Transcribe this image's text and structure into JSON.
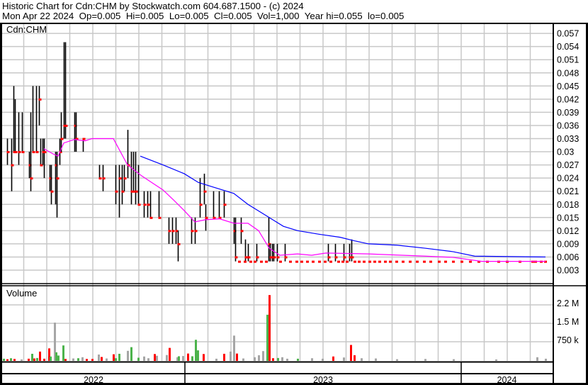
{
  "header": {
    "title": "Historic Chart for Cdn:CHM by Stockwatch.com 604.687.1500 - (c) 2024",
    "summary": "Mon Apr 22 2024  Op=0.005  Hi=0.005  Lo=0.005  Cl=0.005  Vol=1,000  Year hi=0.055  lo=0.005"
  },
  "colors": {
    "bar": "#000000",
    "close_dot": "#ff0000",
    "ma_short": "#ff00ff",
    "ma_long": "#0000ff",
    "vol_up": "#4cb34c",
    "vol_down": "#ff0000",
    "vol_flat": "#a6a6a6",
    "grid": "#c8c8c8"
  },
  "chart_data": [
    {
      "type": "line",
      "title": "Cdn:CHM",
      "xlabel": "",
      "ylabel": "",
      "xlim": [
        0,
        777
      ],
      "ylim": [
        0.0015,
        0.0585
      ],
      "grid": true,
      "yticks": [
        "0.057",
        "0.054",
        "0.051",
        "0.048",
        "0.045",
        "0.042",
        "0.039",
        "0.036",
        "0.033",
        "0.03",
        "0.027",
        "0.024",
        "0.021",
        "0.018",
        "0.015",
        "0.012",
        "0.009",
        "0.006",
        "0.003"
      ],
      "ytick_values": [
        0.057,
        0.054,
        0.051,
        0.048,
        0.045,
        0.042,
        0.039,
        0.036,
        0.033,
        0.03,
        0.027,
        0.024,
        0.021,
        0.018,
        0.015,
        0.012,
        0.009,
        0.006,
        0.003
      ],
      "bars_hlc": [
        [
          7,
          0.033,
          0.027,
          0.03
        ],
        [
          13,
          0.033,
          0.021,
          0.027
        ],
        [
          16,
          0.045,
          0.03,
          0.03
        ],
        [
          18,
          0.042,
          0.03,
          0.03
        ],
        [
          23,
          0.039,
          0.027,
          0.03
        ],
        [
          28,
          0.039,
          0.03,
          0.03
        ],
        [
          38,
          0.03,
          0.024,
          0.027
        ],
        [
          40,
          0.039,
          0.021,
          0.024
        ],
        [
          43,
          0.045,
          0.03,
          0.03
        ],
        [
          48,
          0.045,
          0.03,
          0.03
        ],
        [
          52,
          0.045,
          0.036,
          0.042
        ],
        [
          54,
          0.033,
          0.027,
          0.027
        ],
        [
          57,
          0.033,
          0.027,
          0.03
        ],
        [
          59,
          0.033,
          0.024,
          0.03
        ],
        [
          67,
          0.027,
          0.021,
          0.024
        ],
        [
          69,
          0.027,
          0.018,
          0.021
        ],
        [
          75,
          0.03,
          0.018,
          0.027
        ],
        [
          77,
          0.03,
          0.015,
          0.024
        ],
        [
          81,
          0.033,
          0.027,
          0.03
        ],
        [
          83,
          0.039,
          0.03,
          0.033
        ],
        [
          87,
          0.055,
          0.033,
          0.036
        ],
        [
          89,
          0.055,
          0.033,
          0.036
        ],
        [
          102,
          0.039,
          0.03,
          0.036
        ],
        [
          104,
          0.039,
          0.03,
          0.033
        ],
        [
          114,
          0.033,
          0.03,
          0.033
        ],
        [
          137,
          0.027,
          0.024,
          0.024
        ],
        [
          142,
          0.027,
          0.021,
          0.024
        ],
        [
          160,
          0.027,
          0.018,
          0.021
        ],
        [
          165,
          0.027,
          0.015,
          0.024
        ],
        [
          169,
          0.027,
          0.018,
          0.021
        ],
        [
          172,
          0.027,
          0.021,
          0.024
        ],
        [
          177,
          0.035,
          0.024,
          0.027
        ],
        [
          182,
          0.03,
          0.018,
          0.021
        ],
        [
          185,
          0.03,
          0.021,
          0.021
        ],
        [
          188,
          0.03,
          0.018,
          0.021
        ],
        [
          192,
          0.027,
          0.018,
          0.018
        ],
        [
          200,
          0.021,
          0.015,
          0.018
        ],
        [
          205,
          0.021,
          0.015,
          0.018
        ],
        [
          209,
          0.021,
          0.015,
          0.015
        ],
        [
          221,
          0.021,
          0.015,
          0.015
        ],
        [
          235,
          0.015,
          0.009,
          0.012
        ],
        [
          240,
          0.015,
          0.009,
          0.012
        ],
        [
          245,
          0.015,
          0.009,
          0.012
        ],
        [
          248,
          0.012,
          0.005,
          0.009
        ],
        [
          267,
          0.015,
          0.009,
          0.012
        ],
        [
          272,
          0.015,
          0.009,
          0.012
        ],
        [
          279,
          0.024,
          0.015,
          0.018
        ],
        [
          285,
          0.025,
          0.018,
          0.021
        ],
        [
          287,
          0.018,
          0.012,
          0.015
        ],
        [
          298,
          0.021,
          0.015,
          0.015
        ],
        [
          306,
          0.021,
          0.015,
          0.015
        ],
        [
          313,
          0.021,
          0.015,
          0.018
        ],
        [
          327,
          0.015,
          0.009,
          0.012
        ],
        [
          329,
          0.015,
          0.005,
          0.006
        ],
        [
          337,
          0.015,
          0.009,
          0.012
        ],
        [
          343,
          0.01,
          0.005,
          0.006
        ],
        [
          347,
          0.009,
          0.005,
          0.006
        ],
        [
          359,
          0.009,
          0.005,
          0.006
        ],
        [
          376,
          0.015,
          0.005,
          0.009
        ],
        [
          378,
          0.009,
          0.005,
          0.006
        ],
        [
          381,
          0.009,
          0.005,
          0.006
        ],
        [
          383,
          0.009,
          0.005,
          0.006
        ],
        [
          388,
          0.009,
          0.005,
          0.006
        ],
        [
          399,
          0.009,
          0.005,
          0.006
        ],
        [
          460,
          0.009,
          0.005,
          0.006
        ],
        [
          470,
          0.009,
          0.005,
          0.006
        ],
        [
          482,
          0.009,
          0.005,
          0.006
        ],
        [
          490,
          0.009,
          0.005,
          0.006
        ],
        [
          493,
          0.01,
          0.005,
          0.006
        ]
      ],
      "flat_trades_0_005": [
        334,
        342,
        350,
        356,
        365,
        372,
        392,
        406,
        415,
        422,
        430,
        438,
        447,
        455,
        463,
        474,
        480,
        486,
        497,
        503,
        510,
        518,
        525,
        532,
        540,
        547,
        556,
        565,
        575,
        585,
        595,
        604,
        616,
        625,
        636,
        648,
        660,
        672,
        684,
        700,
        712,
        730,
        748,
        752,
        760,
        766
      ],
      "series": [
        {
          "name": "short moving average",
          "color": "#ff00ff",
          "points": [
            [
              59,
              0.0307
            ],
            [
              72,
              0.0295
            ],
            [
              79,
              0.029
            ],
            [
              87,
              0.032
            ],
            [
              102,
              0.0328
            ],
            [
              117,
              0.0325
            ],
            [
              127,
              0.033
            ],
            [
              157,
              0.033
            ],
            [
              167,
              0.03
            ],
            [
              177,
              0.027
            ],
            [
              197,
              0.0245
            ],
            [
              227,
              0.0213
            ],
            [
              242,
              0.019
            ],
            [
              257,
              0.0166
            ],
            [
              272,
              0.014
            ],
            [
              287,
              0.0145
            ],
            [
              307,
              0.0147
            ],
            [
              327,
              0.0137
            ],
            [
              347,
              0.0137
            ],
            [
              362,
              0.012
            ],
            [
              377,
              0.008
            ],
            [
              392,
              0.0064
            ],
            [
              417,
              0.0067
            ],
            [
              437,
              0.0064
            ],
            [
              457,
              0.0069
            ],
            [
              517,
              0.0067
            ],
            [
              597,
              0.0062
            ],
            [
              637,
              0.0059
            ],
            [
              677,
              0.005
            ],
            [
              767,
              0.005
            ]
          ]
        },
        {
          "name": "long moving average",
          "color": "#0000ff",
          "points": [
            [
              195,
              0.029
            ],
            [
              227,
              0.027
            ],
            [
              257,
              0.025
            ],
            [
              277,
              0.023
            ],
            [
              297,
              0.022
            ],
            [
              327,
              0.0205
            ],
            [
              347,
              0.018
            ],
            [
              377,
              0.015
            ],
            [
              397,
              0.013
            ],
            [
              417,
              0.012
            ],
            [
              447,
              0.0112
            ],
            [
              477,
              0.0105
            ],
            [
              497,
              0.0097
            ],
            [
              517,
              0.009
            ],
            [
              557,
              0.0087
            ],
            [
              597,
              0.008
            ],
            [
              637,
              0.0072
            ],
            [
              667,
              0.0062
            ],
            [
              767,
              0.006
            ]
          ]
        }
      ]
    },
    {
      "type": "bar",
      "title": "Volume",
      "ylim": [
        0,
        3000000
      ],
      "yticks": [
        "2.2 M",
        "1.5 M",
        "750 k"
      ],
      "ytick_values": [
        2250000,
        1500000,
        750000
      ],
      "bars": [
        [
          2,
          60000,
          "up"
        ],
        [
          7,
          40000,
          "down"
        ],
        [
          12,
          80000,
          "up"
        ],
        [
          17,
          50000,
          "down"
        ],
        [
          27,
          30000,
          "flat"
        ],
        [
          37,
          60000,
          "down"
        ],
        [
          42,
          260000,
          "up"
        ],
        [
          45,
          70000,
          "down"
        ],
        [
          49,
          90000,
          "up"
        ],
        [
          53,
          350000,
          "down"
        ],
        [
          59,
          60000,
          "down"
        ],
        [
          66,
          480000,
          "down"
        ],
        [
          68,
          150000,
          "up"
        ],
        [
          74,
          1530000,
          "flat"
        ],
        [
          76,
          320000,
          "up"
        ],
        [
          79,
          190000,
          "up"
        ],
        [
          86,
          600000,
          "up"
        ],
        [
          89,
          50000,
          "down"
        ],
        [
          100,
          70000,
          "flat"
        ],
        [
          107,
          80000,
          "up"
        ],
        [
          113,
          120000,
          "flat"
        ],
        [
          119,
          50000,
          "down"
        ],
        [
          127,
          50000,
          "down"
        ],
        [
          136,
          230000,
          "flat"
        ],
        [
          140,
          130000,
          "down"
        ],
        [
          147,
          70000,
          "flat"
        ],
        [
          157,
          240000,
          "down"
        ],
        [
          160,
          80000,
          "up"
        ],
        [
          165,
          260000,
          "up"
        ],
        [
          177,
          380000,
          "flat"
        ],
        [
          182,
          530000,
          "up"
        ],
        [
          192,
          100000,
          "up"
        ],
        [
          200,
          150000,
          "flat"
        ],
        [
          206,
          80000,
          "flat"
        ],
        [
          215,
          250000,
          "down"
        ],
        [
          218,
          180000,
          "flat"
        ],
        [
          232,
          210000,
          "flat"
        ],
        [
          236,
          500000,
          "down"
        ],
        [
          247,
          120000,
          "flat"
        ],
        [
          249,
          160000,
          "up"
        ],
        [
          255,
          170000,
          "flat"
        ],
        [
          262,
          270000,
          "down"
        ],
        [
          268,
          160000,
          "up"
        ],
        [
          273,
          830000,
          "up"
        ],
        [
          276,
          400000,
          "up"
        ],
        [
          284,
          250000,
          "down"
        ],
        [
          302,
          60000,
          "flat"
        ],
        [
          313,
          260000,
          "down"
        ],
        [
          322,
          350000,
          "flat"
        ],
        [
          327,
          1000000,
          "flat"
        ],
        [
          331,
          270000,
          "down"
        ],
        [
          340,
          70000,
          "flat"
        ],
        [
          356,
          120000,
          "flat"
        ],
        [
          362,
          200000,
          "flat"
        ],
        [
          368,
          370000,
          "flat"
        ],
        [
          374,
          1850000,
          "up"
        ],
        [
          377,
          2650000,
          "down"
        ],
        [
          382,
          80000,
          "down"
        ],
        [
          389,
          90000,
          "up"
        ],
        [
          395,
          120000,
          "flat"
        ],
        [
          402,
          60000,
          "flat"
        ],
        [
          417,
          60000,
          "up"
        ],
        [
          437,
          80000,
          "flat"
        ],
        [
          452,
          60000,
          "flat"
        ],
        [
          467,
          150000,
          "down"
        ],
        [
          482,
          110000,
          "flat"
        ],
        [
          492,
          620000,
          "down"
        ],
        [
          497,
          200000,
          "down"
        ],
        [
          507,
          80000,
          "flat"
        ],
        [
          527,
          70000,
          "flat"
        ],
        [
          557,
          40000,
          "flat"
        ],
        [
          597,
          50000,
          "flat"
        ],
        [
          637,
          40000,
          "flat"
        ],
        [
          697,
          30000,
          "flat"
        ],
        [
          755,
          120000,
          "flat"
        ],
        [
          767,
          60000,
          "flat"
        ]
      ]
    }
  ],
  "xaxis": {
    "years": [
      "2022",
      "2023",
      "2024"
    ],
    "year_starts": [
      258,
      648
    ]
  }
}
